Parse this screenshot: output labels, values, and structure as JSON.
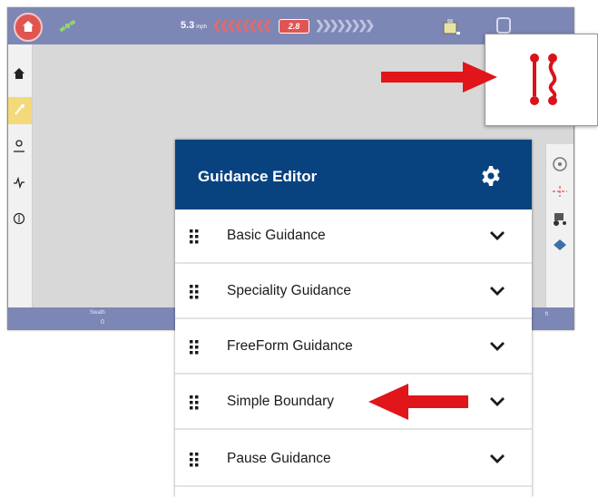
{
  "display": {
    "speed_value": "5.3",
    "speed_unit": "mph",
    "steering_chevrons_left": "❮❮❮❮❮❮❮❮",
    "offset_badge": "2.8",
    "steering_chevrons_right": "❯❯❯❯❯❯❯❯",
    "bottom_label": "Swath",
    "bottom_value": "0",
    "bottom_right": "ft"
  },
  "editor": {
    "title": "Guidance Editor",
    "items": [
      {
        "label": "Basic Guidance"
      },
      {
        "label": "Speciality Guidance"
      },
      {
        "label": "FreeForm Guidance"
      },
      {
        "label": "Simple Boundary"
      },
      {
        "label": "Pause Guidance"
      }
    ]
  },
  "colors": {
    "header_blue": "#08427f",
    "display_bar": "#7d87b6",
    "annotation_red": "#e0161b",
    "home_red": "#e05551"
  },
  "icons": {
    "zoom_icon": "guidance-lines-icon",
    "settings": "gear-icon",
    "drag": "drag-handle-icon",
    "expand": "chevron-down-icon"
  }
}
